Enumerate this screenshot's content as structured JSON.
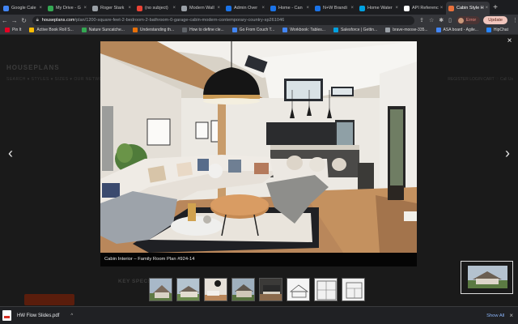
{
  "browser": {
    "tabs": [
      {
        "label": "Google Cale",
        "color": "#4285f4"
      },
      {
        "label": "My Drive - G",
        "color": "#34a853"
      },
      {
        "label": "Roger Stark",
        "color": "#9aa0a6"
      },
      {
        "label": "(no subject)",
        "color": "#ea4335"
      },
      {
        "label": "Modern Wall",
        "color": "#9aa0a6"
      },
      {
        "label": "Admin Over",
        "color": "#1a73e8"
      },
      {
        "label": "Home - Can",
        "color": "#1a73e8"
      },
      {
        "label": "N+W Brandi",
        "color": "#1a73e8"
      },
      {
        "label": "Home Water",
        "color": "#00a1e0"
      },
      {
        "label": "API Referenc",
        "color": "#ffffff"
      },
      {
        "label": "Cabin Style H",
        "color": "#e8713c",
        "active": true
      }
    ],
    "new_tab": "+",
    "address": {
      "domain": "houseplans.com",
      "path": "/plan/1200-square-feet-2-bedroom-2-bathroom-0-garage-cabin-modern-contemporary-country-sp261046"
    },
    "error_label": "Error",
    "update_label": "Update",
    "bookmarks": [
      {
        "label": "Pin It",
        "color": "#e60023"
      },
      {
        "label": "Active Book Roll S...",
        "color": "#fbbc04"
      },
      {
        "label": "Nature Suncatche...",
        "color": "#34a853"
      },
      {
        "label": "Understanding th...",
        "color": "#e8710a"
      },
      {
        "label": "How to define cle...",
        "color": "#5f6368"
      },
      {
        "label": "Go From Couch T...",
        "color": "#4285f4"
      },
      {
        "label": "Workbook: Tables...",
        "color": "#4285f4"
      },
      {
        "label": "Salesforce | Gettin...",
        "color": "#00a1e0"
      },
      {
        "label": "brave-moose-335...",
        "color": "#9aa0a6"
      },
      {
        "label": "ASA board - Agile...",
        "color": "#4285f4"
      },
      {
        "label": "HipChat",
        "color": "#2684ff"
      }
    ]
  },
  "site": {
    "logo": "HOUSEPLANS",
    "nav": "SEARCH ▾   STYLES ▾   SIZES ▾   OUR NETWORK ▾",
    "nav_right": "REGISTER   LOGIN   CART ♡   Call Us",
    "key_specs": "KEY SPECS"
  },
  "lightbox": {
    "close": "×",
    "prev": "‹",
    "next": "›",
    "caption": "Cabin Interior – Family Room Plan #924-14",
    "thumbnails": [
      "exterior-front",
      "exterior-side",
      "interior-living",
      "exterior-rear",
      "interior-kitchen",
      "elevation-drawing",
      "floor-plan-1",
      "floor-plan-2"
    ]
  },
  "downloads": {
    "file_name": "HW Flow Slides.pdf",
    "show_all": "Show All",
    "close": "×"
  }
}
